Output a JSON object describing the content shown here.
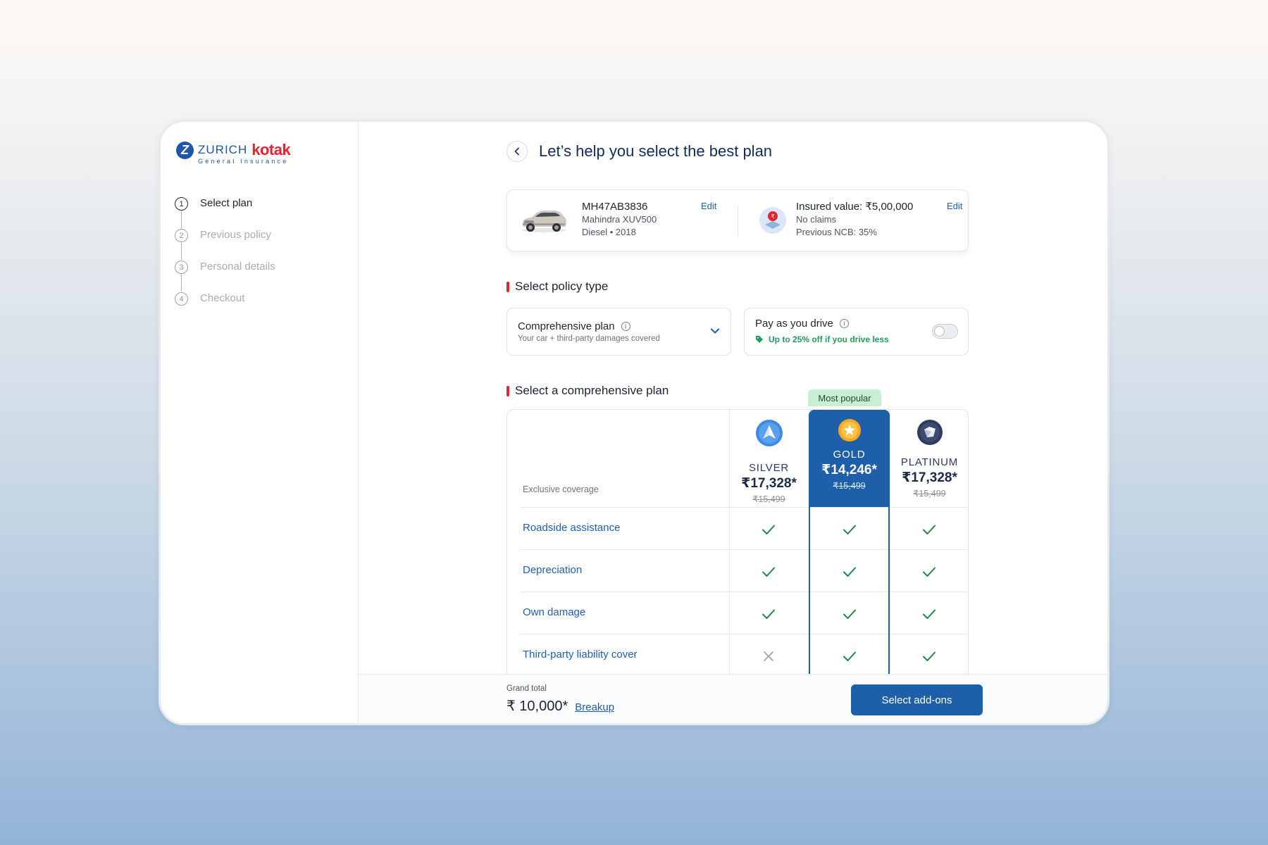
{
  "brand": {
    "zurich": "ZURICH",
    "kotak": "kotak",
    "subtitle": "General Insurance",
    "logo_letter": "Z"
  },
  "steps": [
    {
      "num": "1",
      "label": "Select plan",
      "active": true
    },
    {
      "num": "2",
      "label": "Previous policy",
      "active": false
    },
    {
      "num": "3",
      "label": "Personal details",
      "active": false
    },
    {
      "num": "4",
      "label": "Checkout",
      "active": false
    }
  ],
  "header": {
    "title": "Let’s help you select the best plan"
  },
  "vehicle": {
    "reg": "MH47AB3836",
    "model": "Mahindra XUV500",
    "fuel_year": "Diesel • 2018",
    "edit": "Edit"
  },
  "insurance": {
    "value": "Insured value: ₹5,00,000",
    "claims": "No claims",
    "ncb": "Previous NCB: 35%",
    "edit": "Edit"
  },
  "policy_type": {
    "section_title": "Select policy type",
    "dropdown_title": "Comprehensive plan",
    "dropdown_sub": "Your car + third-party damages covered",
    "payd_title": "Pay as you drive",
    "payd_sub": "Up to 25% off if you drive less",
    "payd_enabled": false
  },
  "plans": {
    "section_title": "Select a comprehensive plan",
    "most_popular": "Most popular",
    "exclusive_label": "Exclusive coverage",
    "columns": [
      {
        "name": "SILVER",
        "price": "₹17,328*",
        "old_price": "₹15,499",
        "icon": "silver-arrow-icon"
      },
      {
        "name": "GOLD",
        "price": "₹14,246*",
        "old_price": "₹15,499",
        "icon": "gold-star-icon"
      },
      {
        "name": "PLATINUM",
        "price": "₹17,328*",
        "old_price": "₹15,499",
        "icon": "platinum-gem-icon"
      }
    ],
    "features": [
      {
        "label": "Roadside assistance",
        "values": [
          true,
          true,
          true
        ]
      },
      {
        "label": "Depreciation",
        "values": [
          true,
          true,
          true
        ]
      },
      {
        "label": "Own damage",
        "values": [
          true,
          true,
          true
        ]
      },
      {
        "label": "Third-party liability cover",
        "values": [
          false,
          true,
          true
        ]
      }
    ]
  },
  "footer": {
    "grand_total_label": "Grand total",
    "grand_total": "₹ 10,000*",
    "breakup": "Breakup",
    "cta": "Select add-ons"
  },
  "colors": {
    "primary": "#1e5fa9",
    "accent_red": "#e1252f",
    "success": "#1f9d5c",
    "popular_bg": "#c9eed3"
  }
}
